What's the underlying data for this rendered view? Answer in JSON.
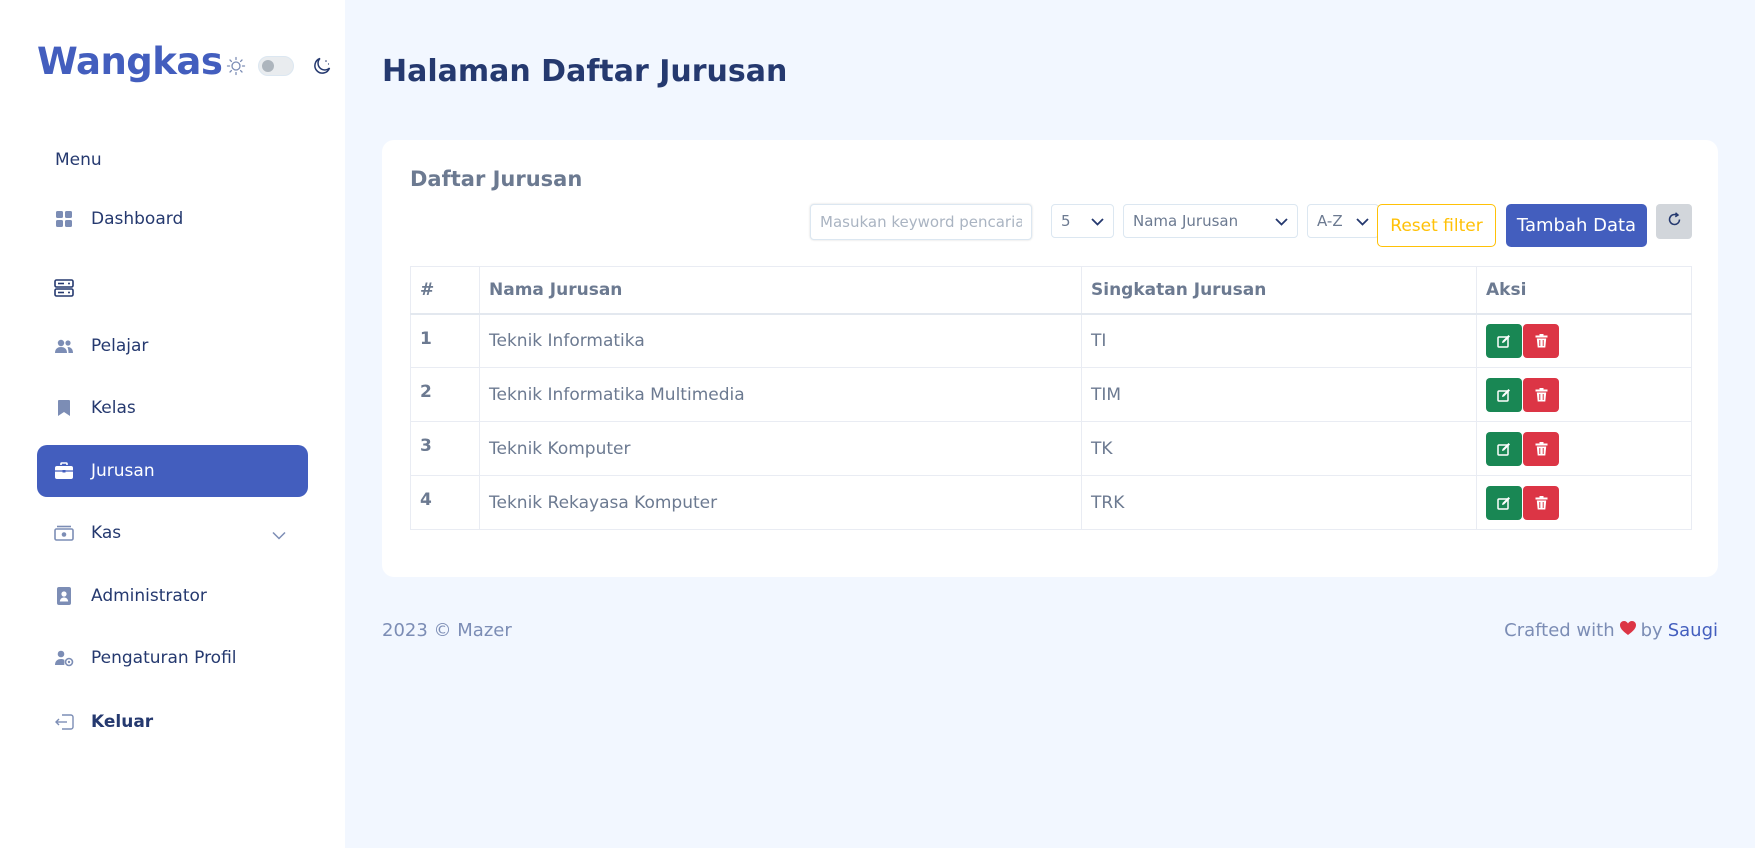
{
  "sidebar": {
    "logo": "Wangkas",
    "menu_title": "Menu",
    "items": [
      {
        "label": "Dashboard",
        "icon": "grid-icon"
      },
      {
        "label": "",
        "icon": "server-icon"
      },
      {
        "label": "Pelajar",
        "icon": "people-icon"
      },
      {
        "label": "Kelas",
        "icon": "bookmark-icon"
      },
      {
        "label": "Jurusan",
        "icon": "briefcase-icon",
        "active": true
      },
      {
        "label": "Kas",
        "icon": "cash-icon",
        "has_submenu": true
      },
      {
        "label": "Administrator",
        "icon": "badge-icon"
      },
      {
        "label": "Pengaturan Profil",
        "icon": "person-gear-icon"
      },
      {
        "label": "Keluar",
        "icon": "logout-icon"
      }
    ]
  },
  "page": {
    "title": "Halaman Daftar Jurusan"
  },
  "card": {
    "title": "Daftar Jurusan",
    "search_placeholder": "Masukan keyword pencarian",
    "per_page": "5",
    "sort_field": "Nama Jurusan",
    "sort_order": "A-Z",
    "reset_label": "Reset filter",
    "add_label": "Tambah Data",
    "columns": [
      "#",
      "Nama Jurusan",
      "Singkatan Jurusan",
      "Aksi"
    ],
    "rows": [
      {
        "no": "1",
        "nama": "Teknik Informatika",
        "singkatan": "TI"
      },
      {
        "no": "2",
        "nama": "Teknik Informatika Multimedia",
        "singkatan": "TIM"
      },
      {
        "no": "3",
        "nama": "Teknik Komputer",
        "singkatan": "TK"
      },
      {
        "no": "4",
        "nama": "Teknik Rekayasa Komputer",
        "singkatan": "TRK"
      }
    ]
  },
  "footer": {
    "left": "2023 © Mazer",
    "crafted": "Crafted with",
    "by": "by",
    "author": "Saugi"
  },
  "colors": {
    "primary": "#435ebe",
    "success": "#198754",
    "danger": "#dc3545",
    "warning": "#ffc107",
    "background": "#f2f7ff"
  }
}
